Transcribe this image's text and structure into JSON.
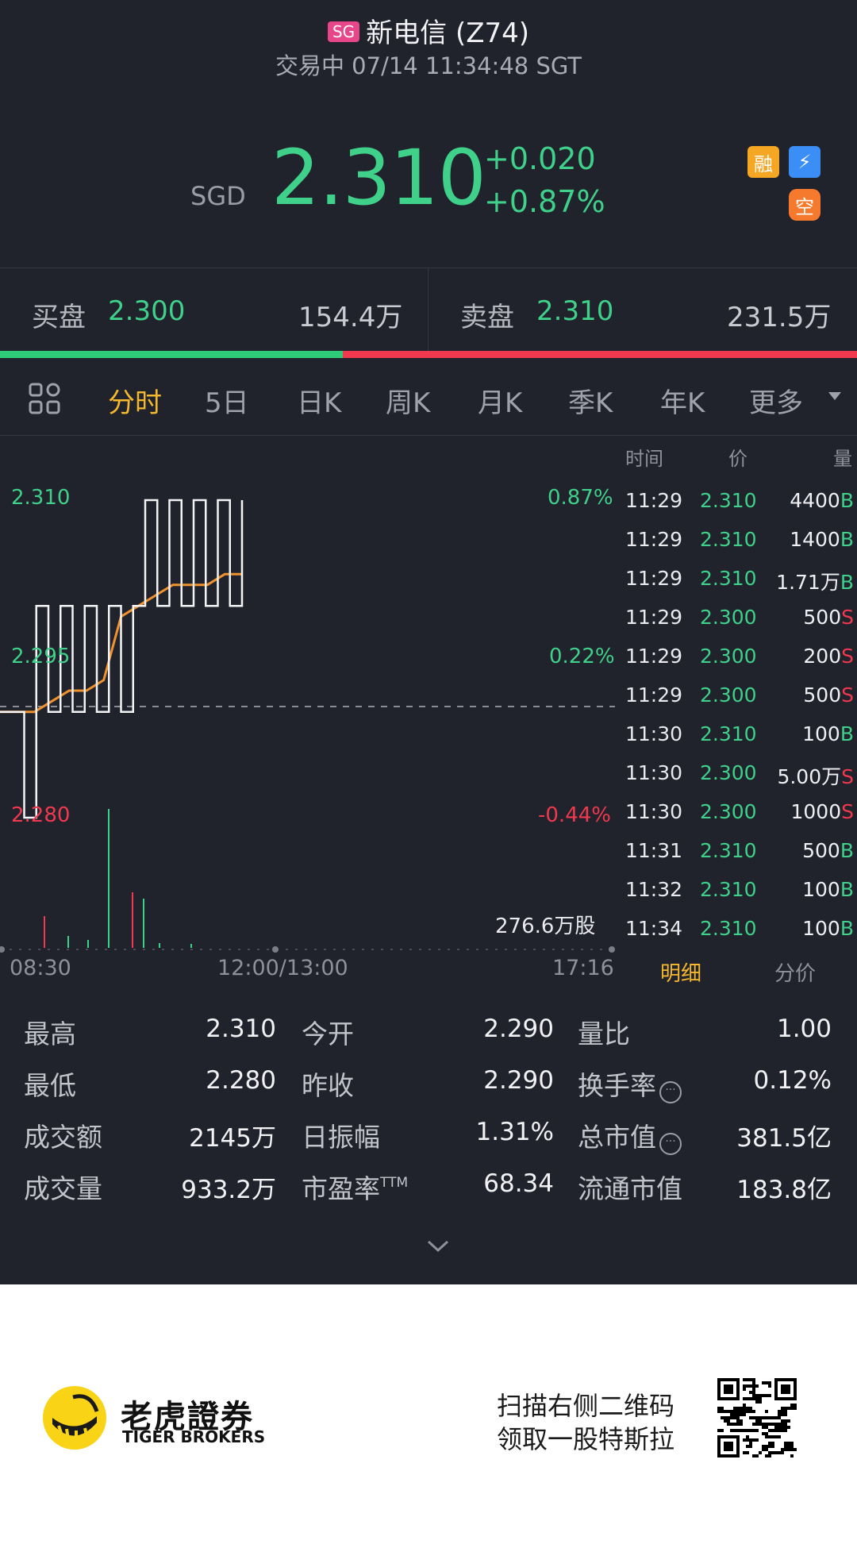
{
  "header": {
    "market_badge": "SG",
    "stock_name": "新电信 (Z74)",
    "status": "交易中 07/14 11:34:48 SGT"
  },
  "quote": {
    "currency": "SGD",
    "price": "2.310",
    "change": "+0.020",
    "change_pct": "+0.87%",
    "tags": [
      "融",
      "⚡",
      "空"
    ]
  },
  "bid_ask": {
    "bid_label": "买盘",
    "bid_price": "2.300",
    "bid_vol": "154.4万",
    "ask_label": "卖盘",
    "ask_price": "2.310",
    "ask_vol": "231.5万",
    "bid_fraction": 0.4
  },
  "tabs": [
    "分时",
    "5日",
    "日K",
    "周K",
    "月K",
    "季K",
    "年K",
    "更多"
  ],
  "active_tab": "分时",
  "chart": {
    "y_high": "2.310",
    "y_mid": "2.295",
    "y_low": "2.280",
    "pct_high": "0.87%",
    "pct_mid": "0.22%",
    "pct_low": "-0.44%",
    "volume_label": "276.6万股",
    "x_labels": [
      "08:30",
      "12:00/13:00",
      "17:16"
    ]
  },
  "chart_data": {
    "type": "line",
    "ylim": [
      2.28,
      2.31
    ],
    "prev_close": 2.29,
    "series": [
      {
        "values": [
          2.29,
          2.29,
          2.28,
          2.3,
          2.29,
          2.3,
          2.29,
          2.3,
          2.29,
          2.3,
          2.29,
          2.3,
          2.31,
          2.3,
          2.31,
          2.3,
          2.31,
          2.3,
          2.31,
          2.3,
          2.31
        ]
      },
      {
        "values": [
          2.29,
          2.29,
          2.29,
          2.291,
          2.292,
          2.292,
          2.293,
          2.299,
          2.3,
          2.301,
          2.302,
          2.302,
          2.302,
          2.303,
          2.303
        ]
      }
    ]
  },
  "ticks": {
    "headers": [
      "时间",
      "价",
      "量"
    ],
    "rows": [
      {
        "time": "11:29",
        "price": "2.310",
        "vol": "4400",
        "side": "B"
      },
      {
        "time": "11:29",
        "price": "2.310",
        "vol": "1400",
        "side": "B"
      },
      {
        "time": "11:29",
        "price": "2.310",
        "vol": "1.71万",
        "side": "B"
      },
      {
        "time": "11:29",
        "price": "2.300",
        "vol": "500",
        "side": "S"
      },
      {
        "time": "11:29",
        "price": "2.300",
        "vol": "200",
        "side": "S"
      },
      {
        "time": "11:29",
        "price": "2.300",
        "vol": "500",
        "side": "S"
      },
      {
        "time": "11:30",
        "price": "2.310",
        "vol": "100",
        "side": "B"
      },
      {
        "time": "11:30",
        "price": "2.300",
        "vol": "5.00万",
        "side": "S"
      },
      {
        "time": "11:30",
        "price": "2.300",
        "vol": "1000",
        "side": "S"
      },
      {
        "time": "11:31",
        "price": "2.310",
        "vol": "500",
        "side": "B"
      },
      {
        "time": "11:32",
        "price": "2.310",
        "vol": "100",
        "side": "B"
      },
      {
        "time": "11:34",
        "price": "2.310",
        "vol": "100",
        "side": "B"
      }
    ],
    "sub_tabs": [
      "明细",
      "分价"
    ]
  },
  "stats": [
    {
      "label": "最高",
      "value": "2.310"
    },
    {
      "label": "今开",
      "value": "2.290"
    },
    {
      "label": "量比",
      "value": "1.00"
    },
    {
      "label": "最低",
      "value": "2.280"
    },
    {
      "label": "昨收",
      "value": "2.290"
    },
    {
      "label": "换手率",
      "value": "0.12%"
    },
    {
      "label": "成交额",
      "value": "2145万"
    },
    {
      "label": "日振幅",
      "value": "1.31%"
    },
    {
      "label": "总市值",
      "value": "381.5亿"
    },
    {
      "label": "成交量",
      "value": "933.2万"
    },
    {
      "label": "市盈率TTM",
      "value": "68.34"
    },
    {
      "label": "流通市值",
      "value": "183.8亿"
    }
  ],
  "footer": {
    "brand_cn": "老虎證券",
    "brand_en": "TIGER BROKERS",
    "promo_line1": "扫描右侧二维码",
    "promo_line2": "领取一股特斯拉"
  },
  "colors": {
    "up": "#3fd08a",
    "down": "#f0384e",
    "accent": "#f5b82e",
    "bg": "#20222c"
  }
}
